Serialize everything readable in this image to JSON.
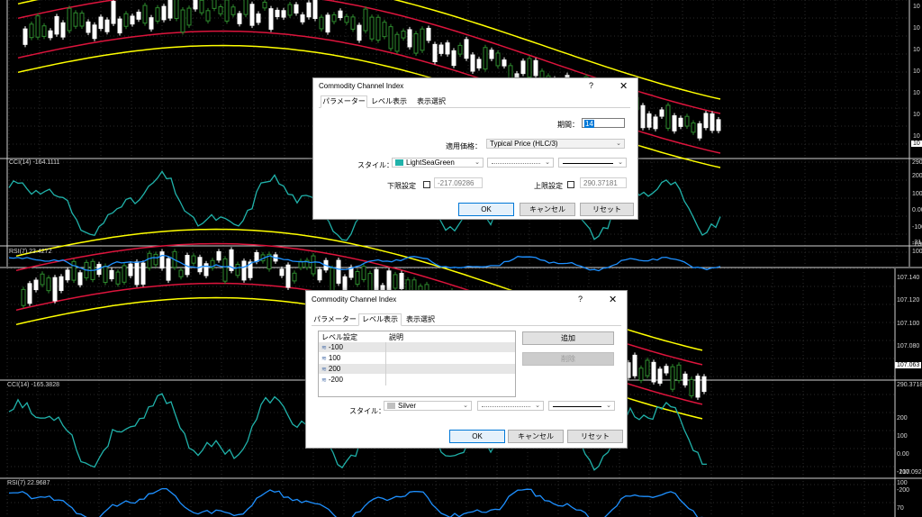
{
  "top_chart": {
    "price_axis": [
      "10",
      "10",
      "10",
      "10",
      "10",
      "10",
      "10"
    ],
    "price_tag": "10",
    "cci_label": "CCI(14) -164.1111",
    "cci_axis": [
      "290",
      "200",
      "100",
      "0.00",
      "-100",
      "-200",
      "-21"
    ],
    "rsi_label": "RSI(7) 23.4272",
    "rsi_axis": [
      "100"
    ]
  },
  "bottom_chart": {
    "price_axis": [
      "107.140",
      "107.120",
      "107.100",
      "107.080"
    ],
    "price_tag": "107.063",
    "cci_label": "CCI(14) -165.3828",
    "cci_axis": [
      "290.3718",
      "200",
      "100",
      "0.00",
      "-100",
      "-200",
      "-217.0928"
    ],
    "rsi_label": "RSI(7) 22.9687",
    "rsi_axis": [
      "100",
      "70"
    ]
  },
  "dialog1": {
    "title": "Commodity Channel Index",
    "help": "?",
    "close": "✕",
    "tabs": [
      "パラメーター",
      "レベル表示",
      "表示選択"
    ],
    "active_tab": 0,
    "period_label": "期間：",
    "period_value": "14",
    "applied_price_label": "適用価格：",
    "applied_price_value": "Typical Price (HLC/3)",
    "style_label": "スタイル：",
    "style_color_name": "LightSeaGreen",
    "style_color": "#20b2aa",
    "lower_limit_label": "下限設定",
    "lower_limit_value": "-217.09286",
    "upper_limit_label": "上限設定",
    "upper_limit_value": "290.37181",
    "ok": "OK",
    "cancel": "キャンセル",
    "reset": "リセット"
  },
  "dialog2": {
    "title": "Commodity Channel Index",
    "help": "?",
    "close": "✕",
    "tabs": [
      "パラメーター",
      "レベル表示",
      "表示選択"
    ],
    "active_tab": 1,
    "col_level": "レベル設定",
    "col_desc": "説明",
    "levels": [
      "-100",
      "100",
      "200",
      "-200"
    ],
    "add": "追加",
    "delete": "削除",
    "style_label": "スタイル：",
    "style_color_name": "Silver",
    "style_color": "#c0c0c0",
    "ok": "OK",
    "cancel": "キャンセル",
    "reset": "リセット"
  },
  "colors": {
    "cci_line": "#20b2aa",
    "rsi_line": "#1e90ff",
    "band_outer": "#ffff00",
    "band_inner": "#dc143c",
    "candle_up": "#ffffff",
    "grid": "#2a2a2a"
  }
}
